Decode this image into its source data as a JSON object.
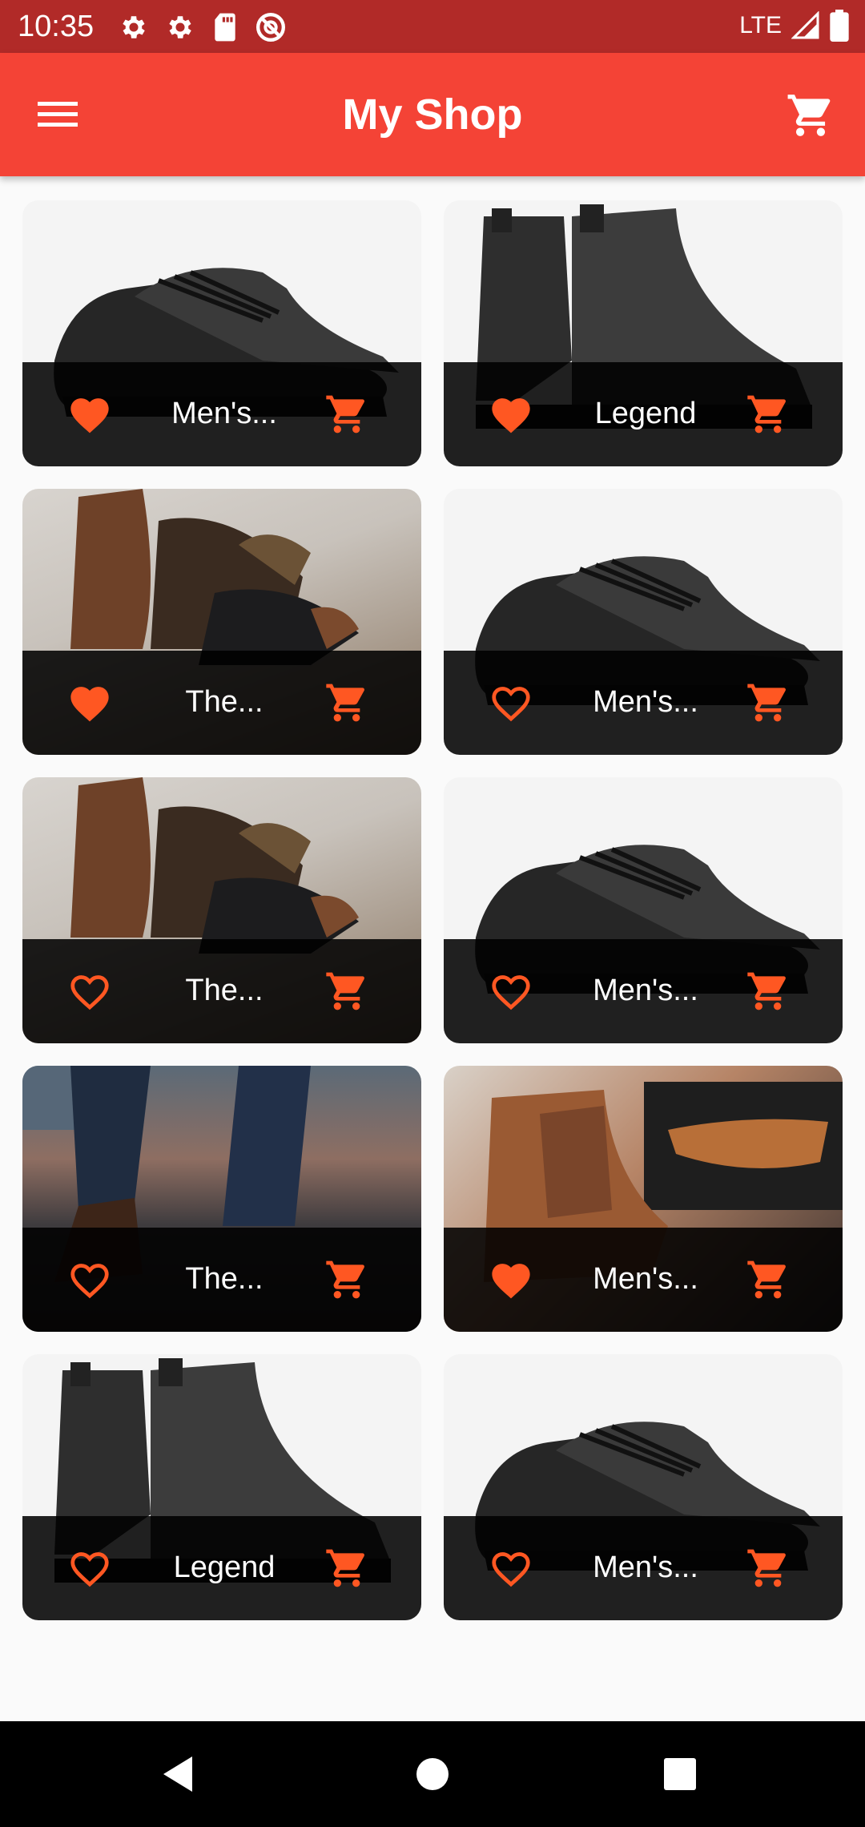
{
  "status_bar": {
    "time": "10:35",
    "network": "LTE",
    "icons_left": [
      "settings-icon",
      "settings-icon",
      "sd-card-icon",
      "do-not-disturb-icon"
    ],
    "icons_right": [
      "signal-icon",
      "battery-icon"
    ]
  },
  "app_bar": {
    "title": "My Shop",
    "menu_icon": "menu-icon",
    "cart_icon": "shopping-cart-icon",
    "background": "#f44336"
  },
  "accent_color": "#ff5722",
  "products": [
    {
      "title": "Men's...",
      "favorite": true,
      "image": "black-sneakers"
    },
    {
      "title": "Legend",
      "favorite": true,
      "image": "black-chelsea-boots"
    },
    {
      "title": "The...",
      "favorite": true,
      "image": "brown-boots-with-dog"
    },
    {
      "title": "Men's...",
      "favorite": false,
      "image": "black-sneakers"
    },
    {
      "title": "The...",
      "favorite": false,
      "image": "brown-boots-with-dog"
    },
    {
      "title": "Men's...",
      "favorite": false,
      "image": "black-sneakers"
    },
    {
      "title": "The...",
      "favorite": false,
      "image": "jeans-and-boots"
    },
    {
      "title": "Men's...",
      "favorite": true,
      "image": "tan-chelsea-boots"
    },
    {
      "title": "Legend",
      "favorite": false,
      "image": "black-chelsea-boots"
    },
    {
      "title": "Men's...",
      "favorite": false,
      "image": "black-sneakers"
    }
  ],
  "nav_bar": {
    "back_icon": "back-triangle-icon",
    "home_icon": "home-circle-icon",
    "recents_icon": "recents-square-icon"
  }
}
